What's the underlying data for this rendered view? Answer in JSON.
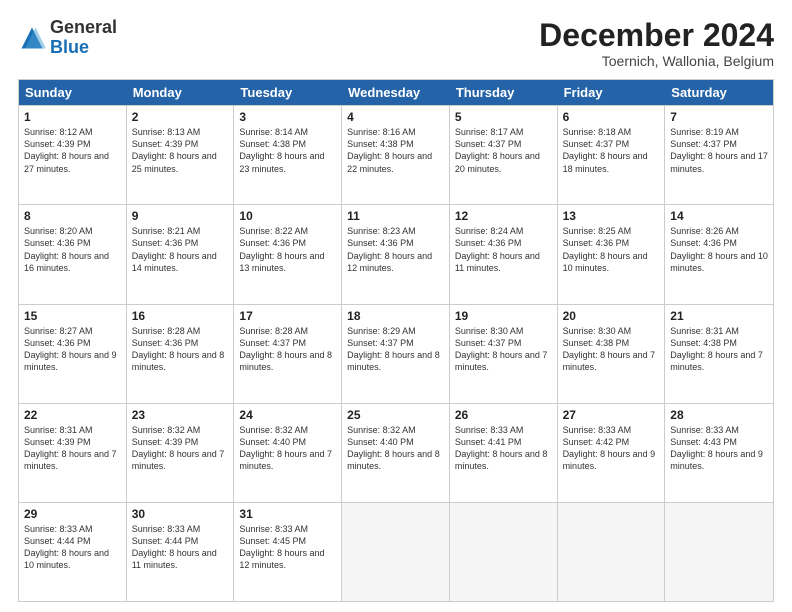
{
  "logo": {
    "general": "General",
    "blue": "Blue"
  },
  "header": {
    "month": "December 2024",
    "location": "Toernich, Wallonia, Belgium"
  },
  "days": [
    "Sunday",
    "Monday",
    "Tuesday",
    "Wednesday",
    "Thursday",
    "Friday",
    "Saturday"
  ],
  "weeks": [
    [
      {
        "day": "1",
        "sunrise": "8:12 AM",
        "sunset": "4:39 PM",
        "daylight": "8 hours and 27 minutes."
      },
      {
        "day": "2",
        "sunrise": "8:13 AM",
        "sunset": "4:39 PM",
        "daylight": "8 hours and 25 minutes."
      },
      {
        "day": "3",
        "sunrise": "8:14 AM",
        "sunset": "4:38 PM",
        "daylight": "8 hours and 23 minutes."
      },
      {
        "day": "4",
        "sunrise": "8:16 AM",
        "sunset": "4:38 PM",
        "daylight": "8 hours and 22 minutes."
      },
      {
        "day": "5",
        "sunrise": "8:17 AM",
        "sunset": "4:37 PM",
        "daylight": "8 hours and 20 minutes."
      },
      {
        "day": "6",
        "sunrise": "8:18 AM",
        "sunset": "4:37 PM",
        "daylight": "8 hours and 18 minutes."
      },
      {
        "day": "7",
        "sunrise": "8:19 AM",
        "sunset": "4:37 PM",
        "daylight": "8 hours and 17 minutes."
      }
    ],
    [
      {
        "day": "8",
        "sunrise": "8:20 AM",
        "sunset": "4:36 PM",
        "daylight": "8 hours and 16 minutes."
      },
      {
        "day": "9",
        "sunrise": "8:21 AM",
        "sunset": "4:36 PM",
        "daylight": "8 hours and 14 minutes."
      },
      {
        "day": "10",
        "sunrise": "8:22 AM",
        "sunset": "4:36 PM",
        "daylight": "8 hours and 13 minutes."
      },
      {
        "day": "11",
        "sunrise": "8:23 AM",
        "sunset": "4:36 PM",
        "daylight": "8 hours and 12 minutes."
      },
      {
        "day": "12",
        "sunrise": "8:24 AM",
        "sunset": "4:36 PM",
        "daylight": "8 hours and 11 minutes."
      },
      {
        "day": "13",
        "sunrise": "8:25 AM",
        "sunset": "4:36 PM",
        "daylight": "8 hours and 10 minutes."
      },
      {
        "day": "14",
        "sunrise": "8:26 AM",
        "sunset": "4:36 PM",
        "daylight": "8 hours and 10 minutes."
      }
    ],
    [
      {
        "day": "15",
        "sunrise": "8:27 AM",
        "sunset": "4:36 PM",
        "daylight": "8 hours and 9 minutes."
      },
      {
        "day": "16",
        "sunrise": "8:28 AM",
        "sunset": "4:36 PM",
        "daylight": "8 hours and 8 minutes."
      },
      {
        "day": "17",
        "sunrise": "8:28 AM",
        "sunset": "4:37 PM",
        "daylight": "8 hours and 8 minutes."
      },
      {
        "day": "18",
        "sunrise": "8:29 AM",
        "sunset": "4:37 PM",
        "daylight": "8 hours and 8 minutes."
      },
      {
        "day": "19",
        "sunrise": "8:30 AM",
        "sunset": "4:37 PM",
        "daylight": "8 hours and 7 minutes."
      },
      {
        "day": "20",
        "sunrise": "8:30 AM",
        "sunset": "4:38 PM",
        "daylight": "8 hours and 7 minutes."
      },
      {
        "day": "21",
        "sunrise": "8:31 AM",
        "sunset": "4:38 PM",
        "daylight": "8 hours and 7 minutes."
      }
    ],
    [
      {
        "day": "22",
        "sunrise": "8:31 AM",
        "sunset": "4:39 PM",
        "daylight": "8 hours and 7 minutes."
      },
      {
        "day": "23",
        "sunrise": "8:32 AM",
        "sunset": "4:39 PM",
        "daylight": "8 hours and 7 minutes."
      },
      {
        "day": "24",
        "sunrise": "8:32 AM",
        "sunset": "4:40 PM",
        "daylight": "8 hours and 7 minutes."
      },
      {
        "day": "25",
        "sunrise": "8:32 AM",
        "sunset": "4:40 PM",
        "daylight": "8 hours and 8 minutes."
      },
      {
        "day": "26",
        "sunrise": "8:33 AM",
        "sunset": "4:41 PM",
        "daylight": "8 hours and 8 minutes."
      },
      {
        "day": "27",
        "sunrise": "8:33 AM",
        "sunset": "4:42 PM",
        "daylight": "8 hours and 9 minutes."
      },
      {
        "day": "28",
        "sunrise": "8:33 AM",
        "sunset": "4:43 PM",
        "daylight": "8 hours and 9 minutes."
      }
    ],
    [
      {
        "day": "29",
        "sunrise": "8:33 AM",
        "sunset": "4:44 PM",
        "daylight": "8 hours and 10 minutes."
      },
      {
        "day": "30",
        "sunrise": "8:33 AM",
        "sunset": "4:44 PM",
        "daylight": "8 hours and 11 minutes."
      },
      {
        "day": "31",
        "sunrise": "8:33 AM",
        "sunset": "4:45 PM",
        "daylight": "8 hours and 12 minutes."
      },
      null,
      null,
      null,
      null
    ]
  ]
}
